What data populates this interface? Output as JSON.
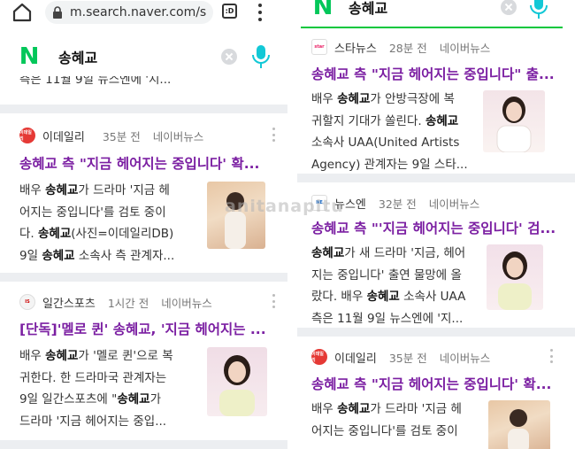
{
  "browser": {
    "url": "m.search.naver.com/s",
    "tab_count": ":D"
  },
  "search": {
    "logo": "N",
    "query": "송혜교"
  },
  "left": {
    "partial_snippet": "측은 11월 9일 뉴스엔에 '지...",
    "articles": [
      {
        "source": "이데일리",
        "time": "35분 전",
        "category": "네이버뉴스",
        "title": "송혜교 측 \"지금 헤어지는 중입니다' 확...",
        "lines": [
          "배우 송혜교가 드라마 '지금 헤",
          "어지는 중입니다'를 검토 중이",
          "다. 송혜교(사진=이데일리DB)",
          "9일 송혜교 소속사 측 관계자..."
        ]
      },
      {
        "source": "일간스포츠",
        "time": "1시간 전",
        "category": "네이버뉴스",
        "title": "[단독]'멜로 퀸' 송혜교, '지금 헤어지는 ...",
        "lines": [
          "배우 송혜교가 '멜로 퀸'으로 복",
          "귀한다. 한 드라마국 관계자는",
          "9일 일간스포츠에 \"송혜교가",
          "드라마 '지금 헤어지는 중입..."
        ]
      }
    ]
  },
  "right": {
    "articles": [
      {
        "source": "스타뉴스",
        "time": "28분 전",
        "category": "네이버뉴스",
        "title": "송혜교 측 \"지금 헤어지는 중입니다\" 출...",
        "lines": [
          "배우 송혜교가 안방극장에 복",
          "귀할지 기대가 쏠린다. 송혜교",
          "소속사 UAA(United Artists",
          "Agency) 관계자는 9일 스타..."
        ]
      },
      {
        "source": "뉴스엔",
        "time": "32분 전",
        "category": "네이버뉴스",
        "title": "송혜교 측 \"'지금 헤어지는 중입니다' 검...",
        "lines": [
          "송혜교가 새 드라마 '지금, 헤어",
          "지는 중입니다' 출연 물망에 올",
          "랐다. 배우 송혜교 소속사 UAA",
          "측은 11월 9일 뉴스엔에 '지..."
        ]
      },
      {
        "source": "이데일리",
        "time": "35분 전",
        "category": "네이버뉴스",
        "title": "송혜교 측 \"지금 헤어지는 중입니다' 확...",
        "lines": [
          "배우 송혜교가 드라마 '지금 헤",
          "어지는 중입니다'를 검토 중이"
        ]
      }
    ]
  },
  "watermark": "anitanapitu",
  "colors": {
    "naver_green": "#03c75a",
    "title_purple": "#7b1fa2",
    "gap_gray": "#eceef1",
    "edaily_red": "#e53935"
  }
}
